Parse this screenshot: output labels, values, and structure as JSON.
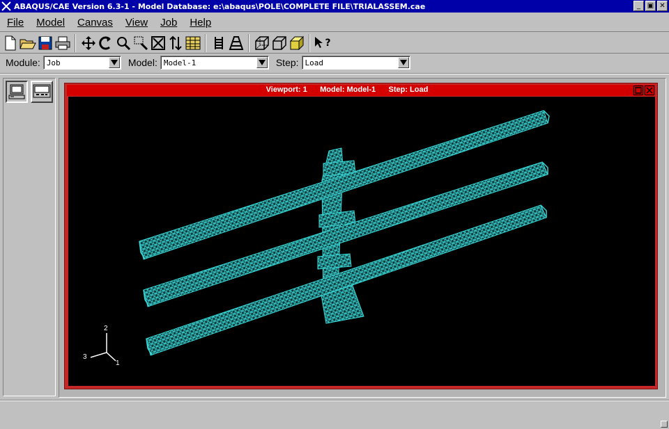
{
  "window": {
    "title": "ABAQUS/CAE Version 6.3-1 - Model Database: e:\\abaqus\\POLE\\COMPLETE FILE\\TRIALASSEM.cae",
    "minimize": "_",
    "maximize": "▣",
    "close": "✕"
  },
  "menu": [
    {
      "label": "File"
    },
    {
      "label": "Model"
    },
    {
      "label": "Canvas"
    },
    {
      "label": "View"
    },
    {
      "label": "Job"
    },
    {
      "label": "Help"
    }
  ],
  "toolbar": {
    "icons": [
      "new-file-icon",
      "open-folder-icon",
      "save-disk-icon",
      "print-icon",
      "pan-icon",
      "rotate-icon",
      "zoom-icon",
      "box-zoom-icon",
      "auto-fit-icon",
      "cycle-views-icon",
      "table-icon",
      "render-wireframe-icon",
      "render-hidden-icon",
      "iso-view-icon",
      "front-view-icon",
      "shaded-cube-icon",
      "context-help-icon"
    ],
    "help_label": "?"
  },
  "context": {
    "module_label": "Module:",
    "module_value": "Job",
    "model_label": "Model:",
    "model_value": "Model-1",
    "step_label": "Step:",
    "step_value": "Load"
  },
  "viewport": {
    "title": "Viewport: 1      Model: Model-1      Step: Load",
    "background": "#000000",
    "frame_color": "#c62828",
    "mesh_color": "#38d6d6",
    "triad": {
      "axis_2": "2",
      "axis_3": "3",
      "axis_1": "1"
    }
  }
}
